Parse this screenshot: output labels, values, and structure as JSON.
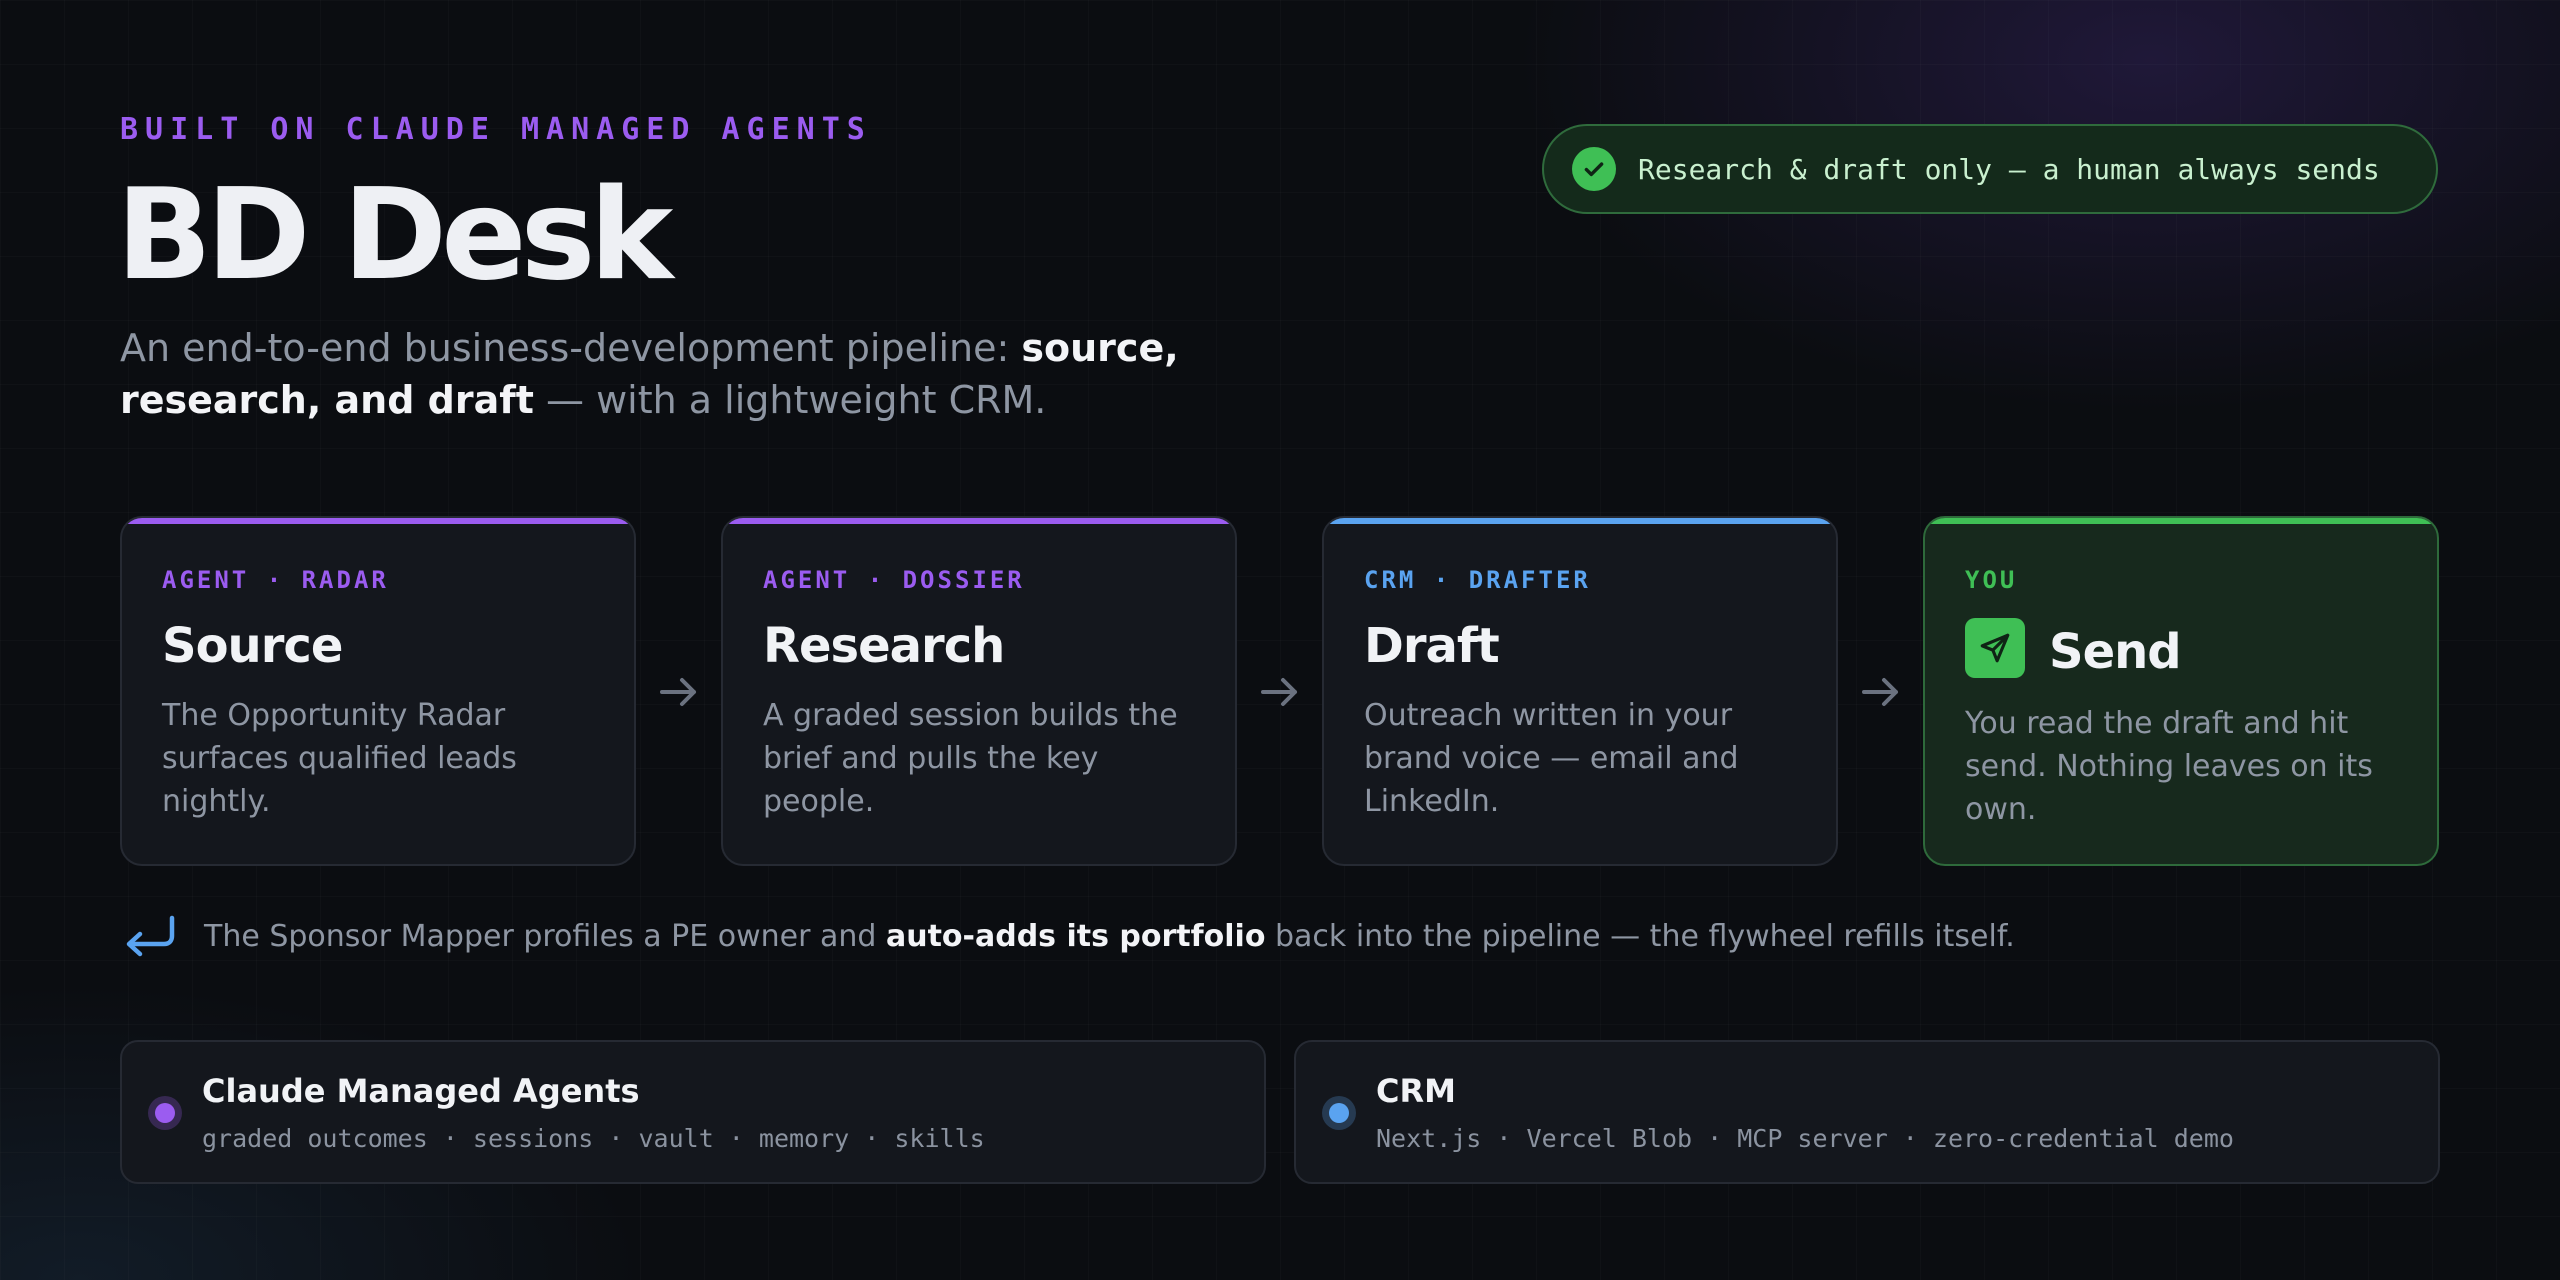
{
  "header": {
    "eyebrow": "BUILT ON CLAUDE MANAGED AGENTS",
    "title": "BD Desk",
    "subtitle_pre": "An end-to-end business-development pipeline: ",
    "subtitle_strong": "source, research, and draft",
    "subtitle_post": " — with a lightweight CRM."
  },
  "badge": {
    "icon": "check-circle-icon",
    "text": "Research & draft only — a human always sends"
  },
  "pipeline": [
    {
      "kicker": "AGENT · RADAR",
      "title": "Source",
      "description": "The Opportunity Radar surfaces qualified leads nightly.",
      "accent": "#9b5cf0"
    },
    {
      "kicker": "AGENT · DOSSIER",
      "title": "Research",
      "description": "A graded session builds the brief and pulls the key people.",
      "accent": "#9b5cf0"
    },
    {
      "kicker": "CRM · DRAFTER",
      "title": "Draft",
      "description": "Outreach written in your brand voice — email and LinkedIn.",
      "accent": "#5aa3f0"
    },
    {
      "kicker": "YOU",
      "title": "Send",
      "icon": "paper-plane-icon",
      "description": "You read the draft and hit send. Nothing leaves on its own.",
      "accent": "#3fbf55"
    }
  ],
  "loop": {
    "icon": "return-arrow-icon",
    "text_pre": "The Sponsor Mapper profiles a PE owner and ",
    "text_strong": "auto-adds its portfolio",
    "text_post": " back into the pipeline — the flywheel refills itself."
  },
  "stack": [
    {
      "title": "Claude Managed Agents",
      "subtitle": "graded outcomes · sessions · vault · memory · skills",
      "color": "#9b5cf0"
    },
    {
      "title": "CRM",
      "subtitle": "Next.js · Vercel Blob · MCP server · zero-credential demo",
      "color": "#5aa3f0"
    }
  ],
  "colors": {
    "purple": "#9b5cf0",
    "blue": "#5aa3f0",
    "green": "#3fbf55",
    "background": "#0b0d11"
  }
}
